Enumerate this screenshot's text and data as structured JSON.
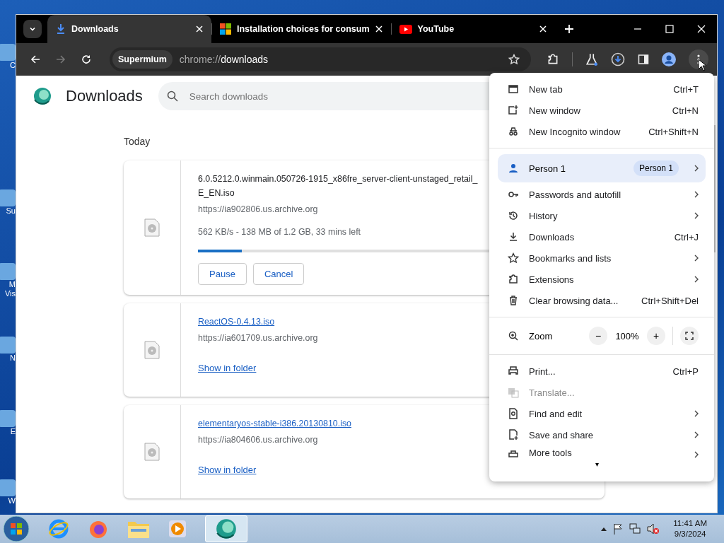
{
  "desktop_icons": [
    {
      "label": "C"
    },
    {
      "label": "Su"
    },
    {
      "label": "M\nVis"
    },
    {
      "label": "N"
    },
    {
      "label": "E"
    },
    {
      "label": "W"
    }
  ],
  "tabs": [
    {
      "title": "Downloads",
      "selected": true
    },
    {
      "title": "Installation choices for consum",
      "selected": false
    },
    {
      "title": "YouTube",
      "selected": false
    }
  ],
  "address_bar": {
    "site_label": "Supermium",
    "url_scheme": "chrome://",
    "url_path": "downloads"
  },
  "page": {
    "title": "Downloads",
    "search": {
      "placeholder": "Search downloads"
    },
    "date_heading": "Today",
    "downloads": [
      {
        "name_lines": [
          "6.0.5212.0.winmain.050726-1915_x86fre_server-client-unstaged_retail_",
          "E_EN.iso"
        ],
        "link": false,
        "source": "https://ia902806.us.archive.org",
        "status": "562 KB/s - 138 MB of 1.2 GB, 33 mins left",
        "level": 0.11,
        "buttons": [
          "Pause",
          "Cancel"
        ]
      },
      {
        "name_lines": [
          "ReactOS-0.4.13.iso"
        ],
        "link": true,
        "source": "https://ia601709.us.archive.org",
        "action_link": "Show in folder"
      },
      {
        "name_lines": [
          "elementaryos-stable-i386.20130810.iso"
        ],
        "link": true,
        "source": "https://ia804606.us.archive.org",
        "action_link": "Show in folder"
      }
    ]
  },
  "menu": {
    "items": [
      {
        "kind": "item",
        "label": "New tab",
        "shortcut": "Ctrl+T",
        "submenu": false,
        "disabled": false
      },
      {
        "kind": "item",
        "label": "New window",
        "shortcut": "Ctrl+N",
        "submenu": false,
        "disabled": false
      },
      {
        "kind": "item",
        "label": "New Incognito window",
        "shortcut": "Ctrl+Shift+N",
        "submenu": false,
        "disabled": false
      },
      {
        "kind": "separator"
      },
      {
        "kind": "profile",
        "label": "Person 1",
        "badge": "Person 1",
        "submenu": true
      },
      {
        "kind": "item",
        "label": "Passwords and autofill",
        "submenu": true,
        "disabled": false
      },
      {
        "kind": "item",
        "label": "History",
        "submenu": true,
        "disabled": false
      },
      {
        "kind": "item",
        "label": "Downloads",
        "shortcut": "Ctrl+J",
        "submenu": false,
        "disabled": false
      },
      {
        "kind": "item",
        "label": "Bookmarks and lists",
        "submenu": true,
        "disabled": false
      },
      {
        "kind": "item",
        "label": "Extensions",
        "submenu": true,
        "disabled": false
      },
      {
        "kind": "item",
        "label": "Clear browsing data...",
        "shortcut": "Ctrl+Shift+Del",
        "submenu": false,
        "disabled": false
      },
      {
        "kind": "separator"
      },
      {
        "kind": "zoom",
        "label": "Zoom",
        "minus": "−",
        "value": "100%",
        "plus": "+"
      },
      {
        "kind": "separator"
      },
      {
        "kind": "item",
        "label": "Print...",
        "shortcut": "Ctrl+P",
        "submenu": false,
        "disabled": false
      },
      {
        "kind": "item",
        "label": "Translate...",
        "submenu": false,
        "disabled": true
      },
      {
        "kind": "item",
        "label": "Find and edit",
        "submenu": true,
        "disabled": false
      },
      {
        "kind": "item",
        "label": "Save and share",
        "submenu": true,
        "disabled": false
      },
      {
        "kind": "cut",
        "label": "More tools",
        "submenu": true,
        "disabled": false
      }
    ],
    "scroll_arrow": "▾"
  },
  "taskbar": {
    "time": "11:41 AM",
    "date": "9/3/2024"
  }
}
